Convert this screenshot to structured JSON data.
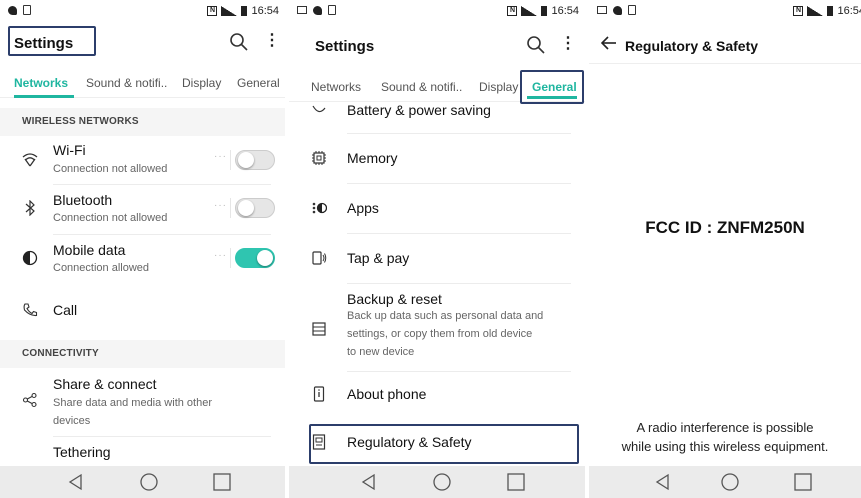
{
  "status": {
    "time": "16:54"
  },
  "panel1": {
    "title": "Settings",
    "tabs": [
      "Networks",
      "Sound & notifi..",
      "Display",
      "General"
    ],
    "sections": {
      "wireless": "WIRELESS NETWORKS",
      "connectivity": "CONNECTIVITY"
    },
    "wifi": {
      "title": "Wi-Fi",
      "sub": "Connection not allowed",
      "icon": "wifi-icon",
      "toggle": "off"
    },
    "bluetooth": {
      "title": "Bluetooth",
      "sub": "Connection not allowed",
      "icon": "bluetooth-icon",
      "toggle": "off"
    },
    "mobile": {
      "title": "Mobile data",
      "sub": "Connection allowed",
      "icon": "mobile-data-icon",
      "toggle": "on"
    },
    "call": {
      "title": "Call",
      "icon": "phone-icon"
    },
    "share": {
      "title": "Share & connect",
      "sub1": "Share data and media with other",
      "sub2": "devices",
      "icon": "share-icon"
    },
    "tethering": {
      "title": "Tethering"
    },
    "dots": "···"
  },
  "panel2": {
    "title": "Settings",
    "tabs": [
      "Networks",
      "Sound & notifi..",
      "Display",
      "General"
    ],
    "battery": "Battery & power saving",
    "memory": "Memory",
    "apps": "Apps",
    "tap": "Tap & pay",
    "backup": {
      "title": "Backup & reset",
      "sub1": "Back up data such as personal data and",
      "sub2": "settings, or copy them from old device",
      "sub3": "to new device"
    },
    "about": "About phone",
    "regulatory": "Regulatory & Safety"
  },
  "panel3": {
    "back_title": "Regulatory & Safety",
    "fcc": "FCC ID : ZNFM250N",
    "note_line1": "A radio interference is possible",
    "note_line2": "while using this wireless equipment."
  },
  "colors": {
    "accent": "#1fb6a0",
    "highlight_box": "#2c3e6b",
    "toggle_on": "#2fc5b0"
  }
}
